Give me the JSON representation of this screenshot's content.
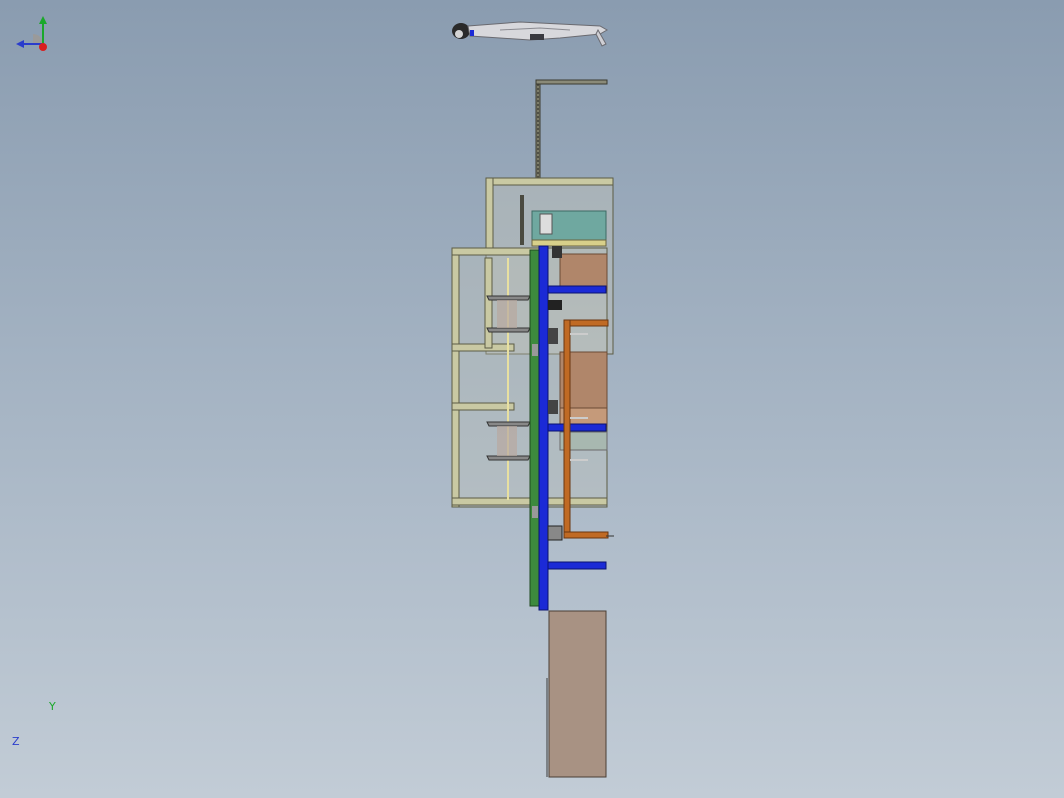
{
  "triad": {
    "y_label": "Y",
    "z_label": "Z",
    "y_color": "#1aa82a",
    "z_color": "#2a3ccc",
    "x_color": "#d81e1e"
  },
  "colors": {
    "background_top": "#8a9cb0",
    "background_bottom": "#c2ccd6",
    "frame": "#c9c9a3",
    "frame_stroke": "#5c5c44",
    "green_plate": "#3d8a3d",
    "blue_beam": "#1b2ad6",
    "orange_tube": "#c06a24",
    "teal_box": "#6fa8a0",
    "brown_panel": "#b0866a",
    "base_block": "#a89283"
  },
  "icons": {
    "triad": "view-orientation-triad-icon",
    "figure": "human-scale-figure-icon"
  }
}
